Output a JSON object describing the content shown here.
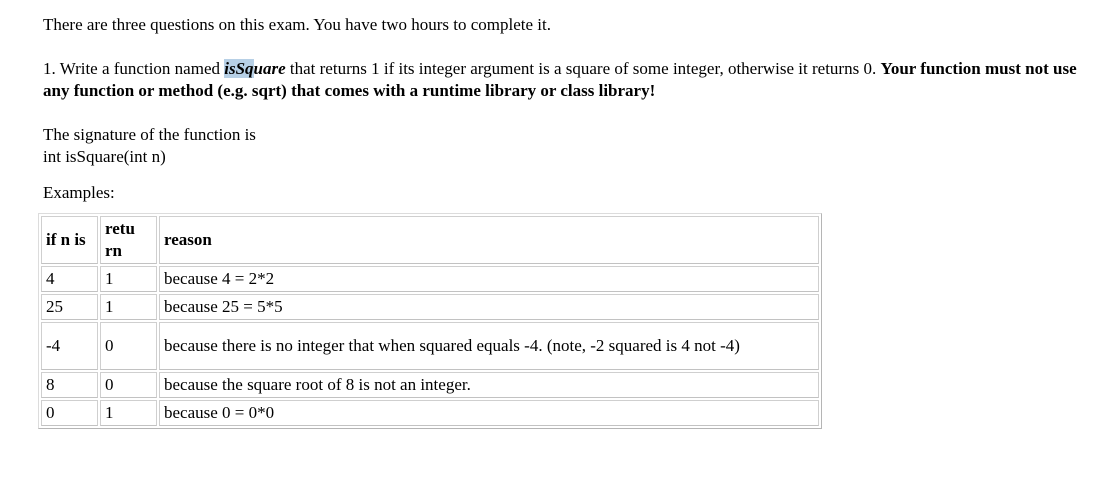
{
  "intro": "There are three questions on this exam. You have two hours to complete it.",
  "question": {
    "number": "1.",
    "lead": "Write a function named",
    "function_name_part1": "isSq",
    "function_name_part2": "uare",
    "after_name": "that returns 1 if its integer argument is a square of some integer, otherwise it returns 0.",
    "bold_note": "Your function must not use any function or method (e.g. sqrt) that comes with a runtime library or class library!"
  },
  "signature": {
    "line1": "The signature of the function is",
    "line2": "int isSquare(int n)"
  },
  "examples_caption": "Examples:",
  "table": {
    "headers": [
      "if n is",
      "retu rn",
      "reason"
    ],
    "rows": [
      {
        "n": "4",
        "ret": "1",
        "reason": "because 4 = 2*2"
      },
      {
        "n": "25",
        "ret": "1",
        "reason": "because 25 = 5*5"
      },
      {
        "n": "-4",
        "ret": "0",
        "reason": "because there is no integer that when squared equals -4. (note, -2 squared is 4 not -4)"
      },
      {
        "n": "8",
        "ret": "0",
        "reason": "because the square root of 8 is not an integer."
      },
      {
        "n": "0",
        "ret": "1",
        "reason": "because 0 = 0*0"
      }
    ]
  },
  "colors": {
    "highlight": "#b7d0e6"
  }
}
